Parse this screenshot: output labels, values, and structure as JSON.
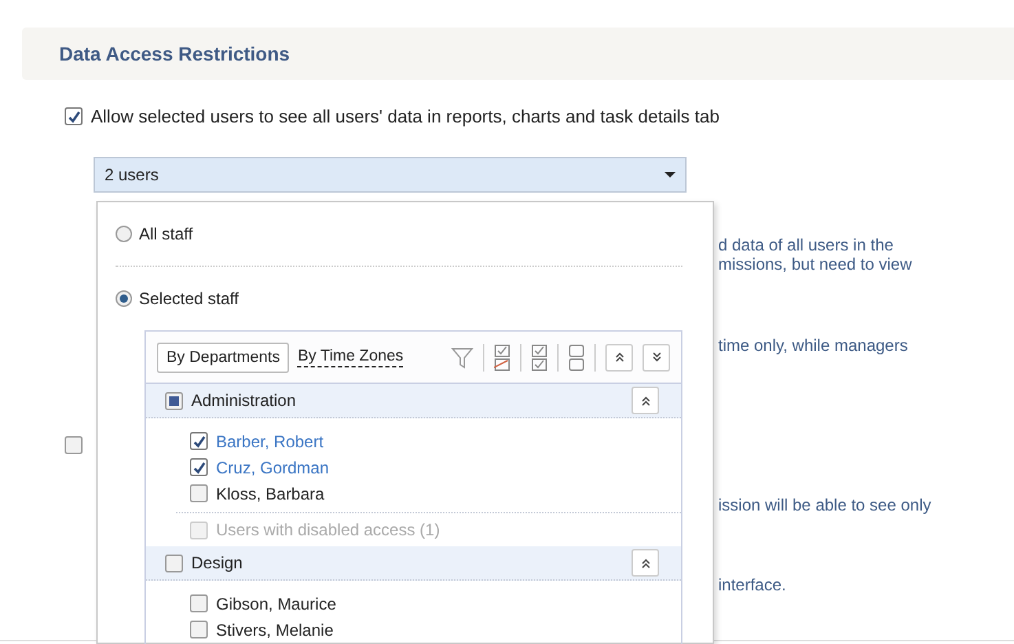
{
  "section": {
    "title": "Data Access Restrictions"
  },
  "allow_option": {
    "label": "Allow selected users to see all users' data in reports, charts and task details tab",
    "checked": true
  },
  "users_dropdown": {
    "value": "2 users",
    "expanded": true
  },
  "background_texts": [
    "d data of all users in the",
    "missions, but need to view",
    "time only, while managers"
  ],
  "second_option": {
    "checked": false
  },
  "background_texts_lower": [
    "ission will be able to see only",
    "interface."
  ],
  "popup": {
    "options": [
      {
        "label": "All staff",
        "selected": false
      },
      {
        "label": "Selected staff",
        "selected": true
      }
    ],
    "tabs": [
      {
        "label": "By Departments",
        "selected": true
      },
      {
        "label": "By Time Zones",
        "selected": false
      }
    ],
    "groups": [
      {
        "name": "Administration",
        "checked": false,
        "partial": true,
        "expanded": true,
        "members": [
          {
            "name": "Barber, Robert",
            "checked": true
          },
          {
            "name": "Cruz, Gordman",
            "checked": true
          },
          {
            "name": "Kloss, Barbara",
            "checked": false
          }
        ],
        "disabled_users": {
          "label": "Users with disabled access (1)",
          "checked": false
        }
      },
      {
        "name": "Design",
        "checked": false,
        "partial": false,
        "expanded": true,
        "members": [
          {
            "name": "Gibson, Maurice",
            "checked": false
          },
          {
            "name": "Stivers, Melanie",
            "checked": false
          }
        ]
      }
    ]
  }
}
